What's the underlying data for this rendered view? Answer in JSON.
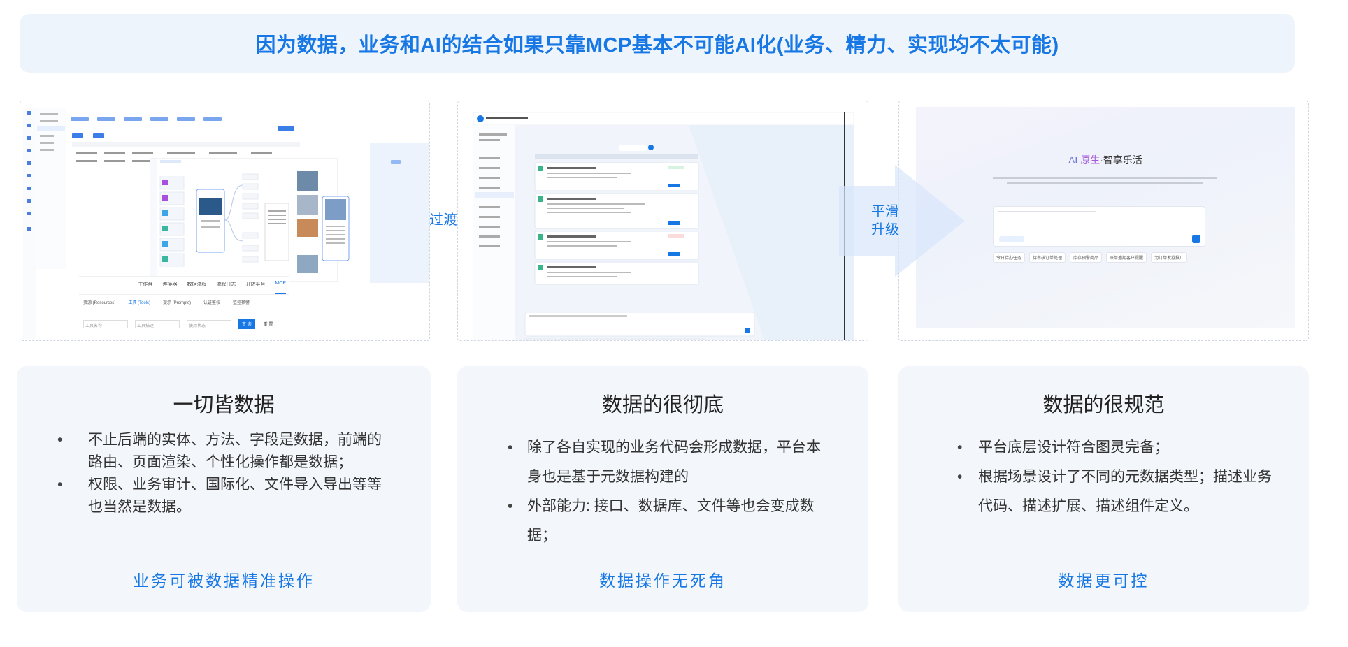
{
  "banner": {
    "title": "因为数据，业务和AI的结合如果只靠MCP基本不可能AI化(业务、精力、实现均不太可能)"
  },
  "transitions": {
    "first": "过渡",
    "second_line1": "平滑",
    "second_line2": "升级"
  },
  "screenshot1": {
    "tabs": [
      "工作台",
      "连接器",
      "数据流程",
      "流程日志",
      "开放平台",
      "MCP"
    ],
    "active_tab": "MCP",
    "subtabs": [
      "资源 (Resources)",
      "工具 (Tools)",
      "提示 (Prompts)",
      "认证鉴权",
      "监控预警"
    ],
    "filters": [
      "工具名称",
      "工具描述",
      "使用状态"
    ],
    "query_button": "查 询",
    "reset_button": "重 置"
  },
  "screenshot3": {
    "brand_prefix": "AI ",
    "brand_highlight": "原生",
    "brand_suffix": "·智享乐活",
    "chips": [
      "今日待办任务",
      "待审核订单处理",
      "库存预警商品",
      "账单逾期客户提醒",
      "为订单发券推广"
    ]
  },
  "cards": [
    {
      "title": "一切皆数据",
      "bullets": [
        "不止后端的实体、方法、字段是数据，前端的路由、页面渲染、个性化操作都是数据；",
        "权限、业务审计、国际化、文件导入导出等等也当然是数据。"
      ],
      "footer": "业务可被数据精准操作"
    },
    {
      "title": "数据的很彻底",
      "bullets": [
        "除了各自实现的业务代码会形成数据，平台本身也是基于元数据构建的",
        "外部能力: 接口、数据库、文件等也会变成数据；"
      ],
      "footer": "数据操作无死角"
    },
    {
      "title": "数据的很规范",
      "bullets": [
        "平台底层设计符合图灵完备；",
        "根据场景设计了不同的元数据类型；描述业务代码、描述扩展、描述组件定义。"
      ],
      "footer": "数据更可控"
    }
  ],
  "colors": {
    "accent": "#1677e5",
    "banner_bg": "#eef4fb",
    "card_bg": "#f3f7fb"
  }
}
